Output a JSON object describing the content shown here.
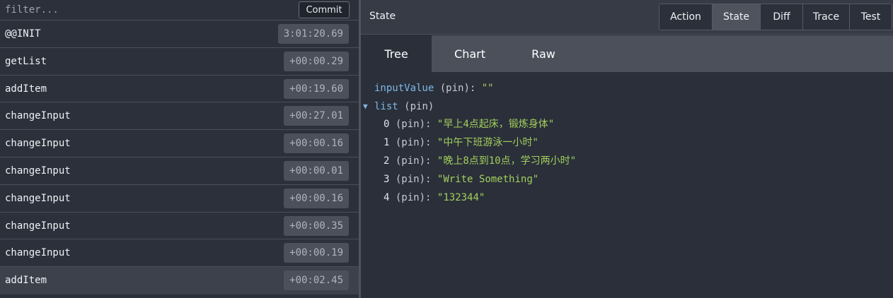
{
  "filter": {
    "placeholder": "filter...",
    "commit_label": "Commit"
  },
  "actions": [
    {
      "name": "@@INIT",
      "time": "3:01:20.69"
    },
    {
      "name": "getList",
      "time": "+00:00.29"
    },
    {
      "name": "addItem",
      "time": "+00:19.60"
    },
    {
      "name": "changeInput",
      "time": "+00:27.01"
    },
    {
      "name": "changeInput",
      "time": "+00:00.16"
    },
    {
      "name": "changeInput",
      "time": "+00:00.01"
    },
    {
      "name": "changeInput",
      "time": "+00:00.16"
    },
    {
      "name": "changeInput",
      "time": "+00:00.35"
    },
    {
      "name": "changeInput",
      "time": "+00:00.19"
    },
    {
      "name": "addItem",
      "time": "+00:02.45",
      "selected": true
    }
  ],
  "header": {
    "title": "State",
    "mode_tabs": [
      "Action",
      "State",
      "Diff",
      "Trace",
      "Test"
    ],
    "active_mode": "State"
  },
  "view_tabs": {
    "items": [
      "Tree",
      "Chart",
      "Raw"
    ],
    "active": "Tree"
  },
  "tree": {
    "inputValue": {
      "key": "inputValue",
      "pin": "(pin):",
      "value": "\"\""
    },
    "list": {
      "arrow": "▼",
      "key": "list",
      "pin": "(pin)",
      "items": [
        {
          "index": "0",
          "pin": "(pin):",
          "value": "\"早上4点起床，锻炼身体\""
        },
        {
          "index": "1",
          "pin": "(pin):",
          "value": "\"中午下班游泳一小时\""
        },
        {
          "index": "2",
          "pin": "(pin):",
          "value": "\"晚上8点到10点，学习两小时\""
        },
        {
          "index": "3",
          "pin": "(pin):",
          "value": "\"Write Something\""
        },
        {
          "index": "4",
          "pin": "(pin):",
          "value": "\"132344\""
        }
      ]
    }
  }
}
